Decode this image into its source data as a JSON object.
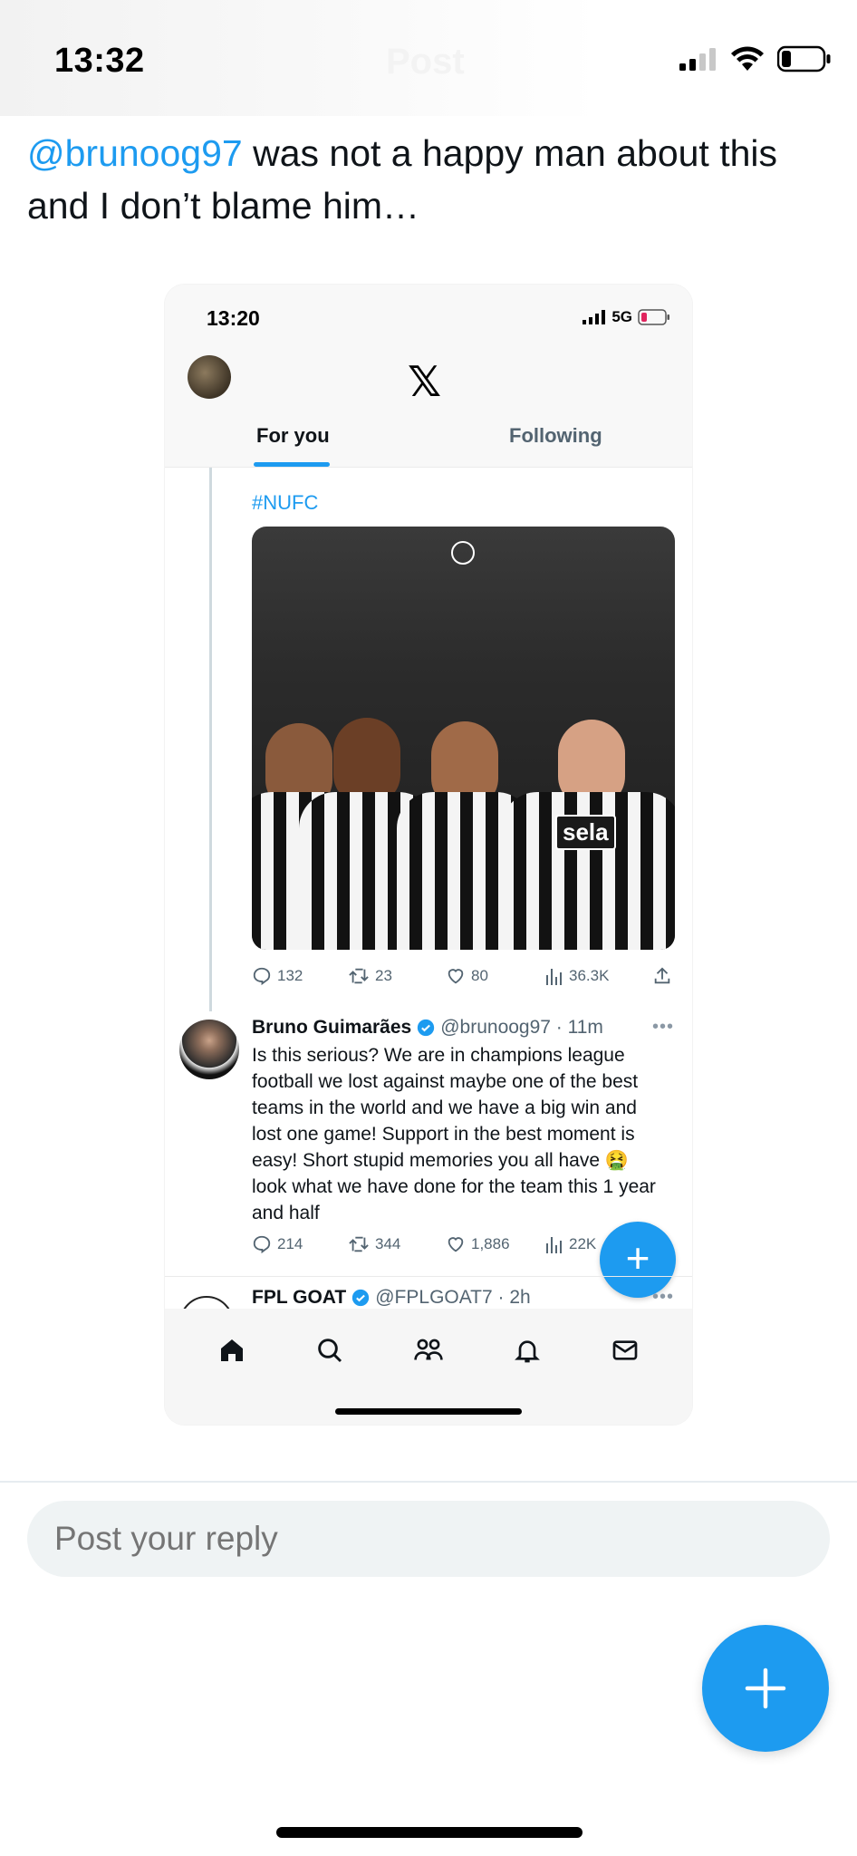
{
  "status_bar": {
    "time": "13:32",
    "header_ghost": "Post",
    "icons": [
      "signal-icon",
      "wifi-icon",
      "battery-icon"
    ]
  },
  "tweet": {
    "mention": "@brunoog97",
    "text": " was not a happy man about this and I don’t blame him…"
  },
  "embedded": {
    "status_time": "13:20",
    "network": "5G",
    "logo": "𝕏",
    "tabs": [
      {
        "label": "For you",
        "active": true
      },
      {
        "label": "Following",
        "active": false
      }
    ],
    "post": {
      "hashtag": "#NUFC",
      "sponsor": "sela",
      "stats": {
        "replies": "132",
        "reposts": "23",
        "likes": "80",
        "views": "36.3K"
      }
    },
    "reply": {
      "name": "Bruno Guimarães",
      "handle": "@brunoog97 · 11m",
      "text": "Is this serious? We are in champions league football we lost against maybe one of the best teams in the world and we have a big win and lost one game! Support in the best moment is easy! Short stupid memories you all have 🤮look what we have done for the team this 1 year and half",
      "stats": {
        "replies": "214",
        "reposts": "344",
        "likes": "1,886",
        "views": "22K"
      }
    },
    "next_post": {
      "name": "FPL GOAT",
      "handle": "@FPLGOAT7 · 2h"
    },
    "tabbar": [
      "home-icon",
      "search-icon",
      "communities-icon",
      "notifications-icon",
      "messages-icon"
    ]
  },
  "reply_box": {
    "placeholder": "Post your reply"
  },
  "colors": {
    "accent": "#1d9bf0",
    "text": "#0f1419",
    "muted": "#536471"
  }
}
